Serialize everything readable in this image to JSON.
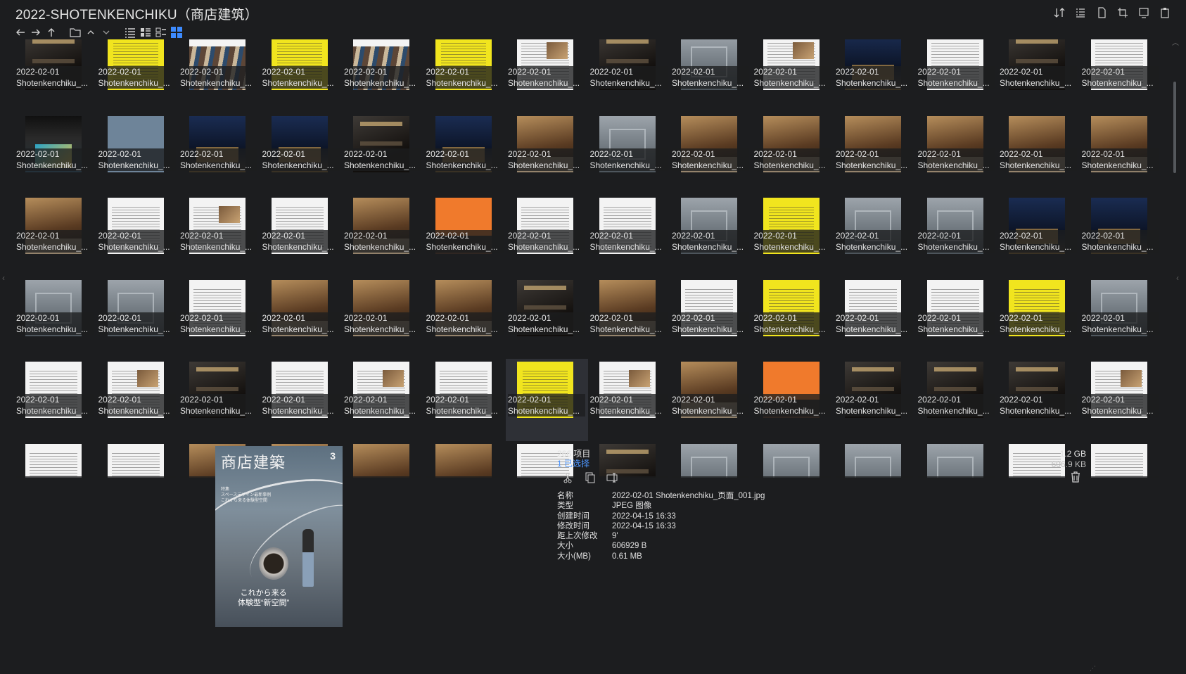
{
  "window": {
    "title": "2022-SHOTENKENCHIKU（商店建筑）"
  },
  "thumbs": {
    "label_date": "2022-02-01",
    "label_name": "Shotenkenchiku_...",
    "styles": [
      "dark",
      "yellow",
      "stripe",
      "yellow",
      "stripe",
      "yellow",
      "doc",
      "dark",
      "grey",
      "doc",
      "blue",
      "doc",
      "dark",
      "doc",
      "cover",
      "slate",
      "blue",
      "blue",
      "dark",
      "blue",
      "warm",
      "grey",
      "warm",
      "warm",
      "warm",
      "warm",
      "warm",
      "warm",
      "warm",
      "doc",
      "doc",
      "doc",
      "warm",
      "orange",
      "doc",
      "doc",
      "grey",
      "yellow",
      "grey",
      "grey",
      "blue",
      "blue",
      "grey",
      "grey",
      "doc",
      "warm",
      "warm",
      "warm",
      "dark",
      "warm",
      "doc",
      "yellow",
      "doc",
      "doc",
      "yellow",
      "grey",
      "doc",
      "doc",
      "dark",
      "doc",
      "doc",
      "doc",
      "yellow",
      "doc",
      "warm",
      "orange",
      "dark",
      "dark",
      "dark",
      "doc",
      "doc",
      "doc",
      "warm",
      "warm",
      "warm",
      "warm",
      "doc",
      "dark",
      "grey",
      "grey",
      "grey",
      "grey",
      "doc",
      "doc"
    ],
    "selected_index": 62
  },
  "status": {
    "item_count": "266 项目",
    "selected_count": "1 已选择",
    "size_total": "1.2 GB",
    "size_selected": "606.9 KB"
  },
  "cover": {
    "masthead": "商店建築",
    "issue": "3",
    "lines": "特集\nスペースデザイン最新事例\nこれから来る体験型空間",
    "feature": "これから来る\n体験型“新空間”"
  },
  "properties": [
    {
      "key": "名称",
      "value": "2022-02-01 Shotenkenchiku_页面_001.jpg"
    },
    {
      "key": "类型",
      "value": "JPEG 图像"
    },
    {
      "key": "创建时间",
      "value": "2022-04-15  16:33"
    },
    {
      "key": "修改时间",
      "value": "2022-04-15  16:33"
    },
    {
      "key": "距上次修改",
      "value": "9'"
    },
    {
      "key": "大小",
      "value": "606929 B"
    },
    {
      "key": "大小(MB)",
      "value": "0.61 MB"
    }
  ],
  "icons": {
    "sort": "sort-icon",
    "list_details": "details-pane-icon",
    "file": "file-icon",
    "crop": "crop-icon",
    "window": "window-icon",
    "clipboard": "clipboard-icon",
    "cut": "scissors-icon",
    "copy": "copy-icon",
    "rename": "rename-icon",
    "trash": "trash-icon"
  },
  "colors": {
    "background": "#1c1d1f",
    "accent": "#4d96ff",
    "selected_view": "#3d8bff"
  }
}
